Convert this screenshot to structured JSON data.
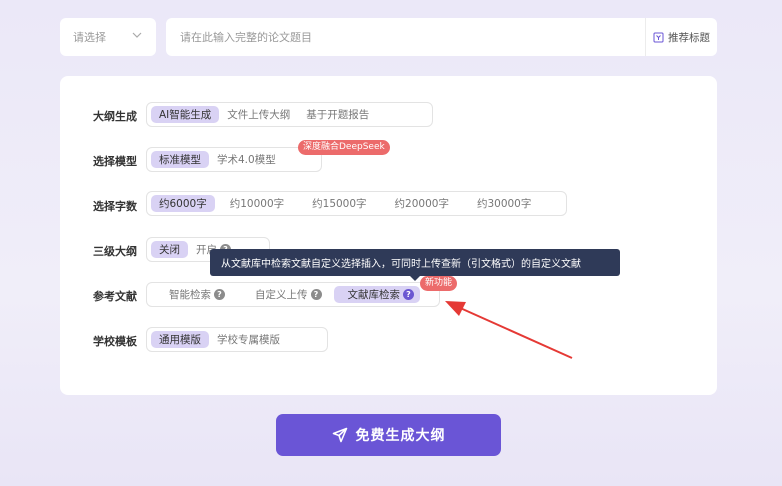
{
  "top": {
    "select_placeholder": "请选择",
    "title_placeholder": "请在此输入完整的论文题目",
    "recommend_label": "推荐标题"
  },
  "rows": [
    {
      "label": "大纲生成",
      "options": [
        "AI智能生成",
        "文件上传大纲",
        "基于开题报告"
      ],
      "selected": 0
    },
    {
      "label": "选择模型",
      "options": [
        "标准模型",
        "学术4.0模型"
      ],
      "selected": 0,
      "badge": "深度融合DeepSeek"
    },
    {
      "label": "选择字数",
      "options": [
        "约6000字",
        "约10000字",
        "约15000字",
        "约20000字",
        "约30000字"
      ],
      "selected": 0
    },
    {
      "label": "三级大纲",
      "options": [
        "关闭",
        "开启"
      ],
      "selected": 0
    },
    {
      "label": "参考文献",
      "options": [
        "智能检索",
        "自定义上传",
        "文献库检索"
      ],
      "selected": 2,
      "badge": "新功能"
    },
    {
      "label": "学校模板",
      "options": [
        "通用模版",
        "学校专属模版"
      ],
      "selected": 0
    }
  ],
  "tooltip": "从文献库中检索文献自定义选择插入，可同时上传查新（引文格式）的自定义文献",
  "generate_button": "免费生成大纲",
  "colors": {
    "accent": "#6a55d6",
    "selected_bg": "#d9d2f4",
    "badge": "#ec6b6b",
    "tooltip_bg": "#2f3a58",
    "arrow": "#e53935"
  },
  "icons": {
    "select": "chevron-down-icon",
    "recommend": "bookmark-icon",
    "help": "question-circle-icon",
    "send": "paper-plane-icon"
  }
}
